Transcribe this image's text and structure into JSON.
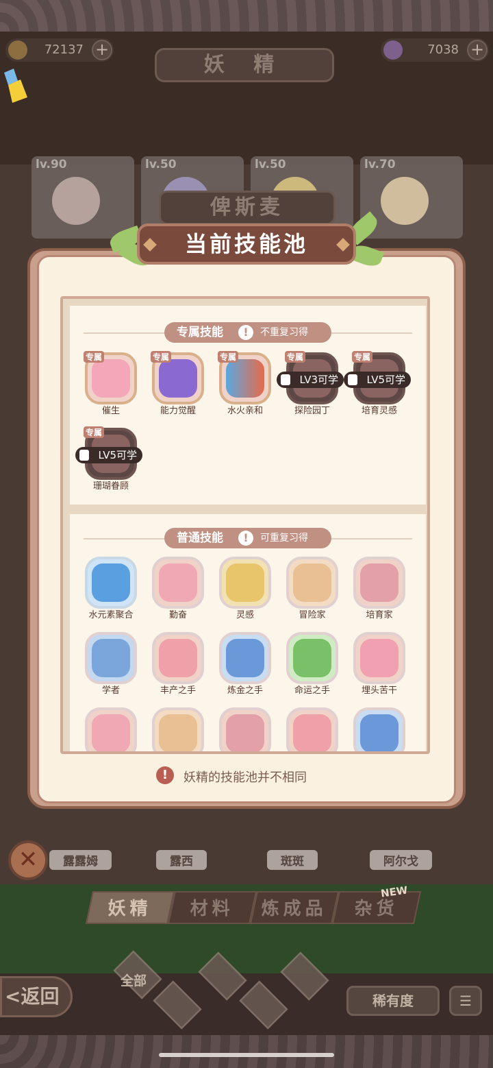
{
  "header": {
    "currency_left": "72137",
    "currency_right": "7038",
    "title": "妖 精"
  },
  "cards": [
    {
      "level": "lv.90"
    },
    {
      "level": "lv.50"
    },
    {
      "level": "lv.50"
    },
    {
      "level": "lv.70"
    }
  ],
  "character_name": "俾斯麦",
  "panel": {
    "title": "当前技能池",
    "exclusive": {
      "title": "专属技能",
      "note": "不重复习得",
      "tag": "专属",
      "skills": [
        {
          "name": "催生",
          "lock": ""
        },
        {
          "name": "能力觉醒",
          "lock": ""
        },
        {
          "name": "水火亲和",
          "lock": ""
        },
        {
          "name": "探险园丁",
          "lock": "LV3可学"
        },
        {
          "name": "培育灵感",
          "lock": "LV5可学"
        },
        {
          "name": "珊瑚眷顾",
          "lock": "LV5可学"
        }
      ]
    },
    "common": {
      "title": "普通技能",
      "note": "可重复习得",
      "skills": [
        {
          "name": "水元素聚合"
        },
        {
          "name": "勤奋"
        },
        {
          "name": "灵感"
        },
        {
          "name": "冒险家"
        },
        {
          "name": "培育家"
        },
        {
          "name": "学者"
        },
        {
          "name": "丰产之手"
        },
        {
          "name": "炼金之手"
        },
        {
          "name": "命运之手"
        },
        {
          "name": "埋头苦干"
        }
      ]
    },
    "footnote": "妖精的技能池并不相同"
  },
  "bottom": {
    "names": [
      "露露姆",
      "露西",
      "斑斑",
      "阿尔戈"
    ],
    "tabs": [
      "妖精",
      "材料",
      "炼成品",
      "杂货"
    ],
    "new_badge": "NEW",
    "back": "<返回",
    "filter_all": "全部",
    "rarity": "稀有度"
  },
  "colors": {
    "accent": "#7a4a3c",
    "panel_bg": "#faf1e0",
    "section_tag": "#c09083"
  }
}
